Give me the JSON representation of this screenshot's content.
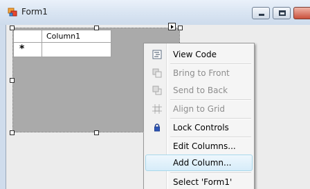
{
  "window": {
    "title": "Form1",
    "controls": [
      "minimize",
      "maximize",
      "close"
    ]
  },
  "grid": {
    "columns": [
      "Column1"
    ],
    "new_row_marker": "*"
  },
  "context_menu": {
    "items": [
      {
        "label": "View Code",
        "icon": "view-code-icon",
        "enabled": true
      },
      {
        "label": "Bring to Front",
        "icon": "bring-to-front-icon",
        "enabled": false
      },
      {
        "label": "Send to Back",
        "icon": "send-to-back-icon",
        "enabled": false
      },
      {
        "label": "Align to Grid",
        "icon": "align-to-grid-icon",
        "enabled": false
      },
      {
        "label": "Lock Controls",
        "icon": "lock-icon",
        "enabled": true
      },
      {
        "label": "Edit Columns...",
        "icon": "",
        "enabled": true
      },
      {
        "label": "Add Column...",
        "icon": "",
        "enabled": true,
        "highlighted": true
      },
      {
        "label": "Select 'Form1'",
        "icon": "",
        "enabled": true
      }
    ]
  },
  "colors": {
    "titlebar": "#dbe6f3",
    "grid_background": "#aaaaaa",
    "menu_highlight": "#d6ecf9",
    "disabled_text": "#8d8d8d"
  }
}
